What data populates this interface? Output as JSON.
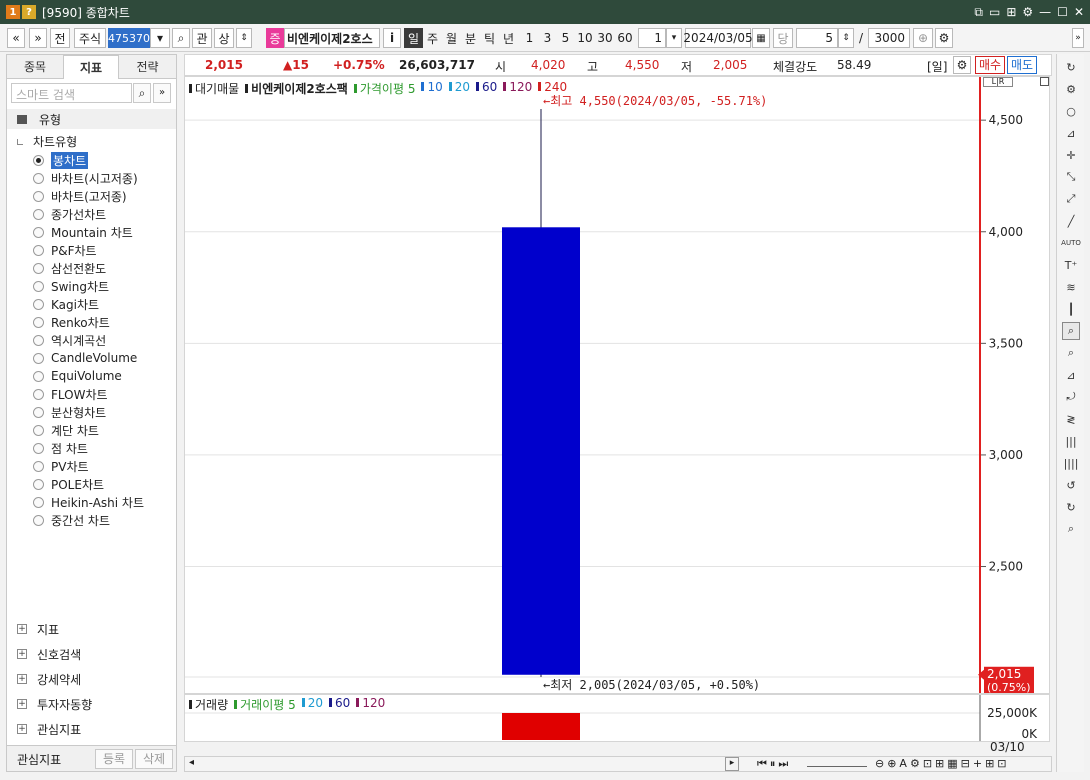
{
  "window": {
    "title": "[9590] 종합차트",
    "icon1": "1",
    "icon2": "?",
    "buttons": [
      "⧉",
      "▭",
      "⊞",
      "⚙",
      "—",
      "☐",
      "✕"
    ]
  },
  "toolbar": {
    "back": "«",
    "down": "»",
    "prev_label": "전",
    "type_label": "주식",
    "code": "475370",
    "rel_label": "관",
    "up_label": "상",
    "market_badge": "증",
    "stock_name": "비엔케이제2호스",
    "info_label": "i",
    "periods": [
      "일",
      "주",
      "월",
      "분",
      "틱",
      "년"
    ],
    "intervals": [
      "1",
      "3",
      "5",
      "10",
      "30",
      "60"
    ],
    "count": "1",
    "date": "2024/03/05",
    "per_label": "당",
    "display_count": "5",
    "slash": "/",
    "total": "3000"
  },
  "left_panel": {
    "tabs": [
      "종목",
      "지표",
      "전략"
    ],
    "search_placeholder": "스마트 검색",
    "group_label": "유형",
    "subgroup_label": "차트유형",
    "chart_types": [
      "봉차트",
      "바차트(시고저종)",
      "바차트(고저종)",
      "종가선차트",
      "Mountain 차트",
      "P&F차트",
      "삼선전환도",
      "Swing차트",
      "Kagi차트",
      "Renko차트",
      "역시계곡선",
      "CandleVolume",
      "EquiVolume",
      "FLOW차트",
      "분산형차트",
      "계단 차트",
      "점 차트",
      "PV차트",
      "POLE차트",
      "Heikin-Ashi 차트",
      "중간선 차트"
    ],
    "bottom_sections": [
      "지표",
      "신호검색",
      "강세약세",
      "투자자동향",
      "관심지표"
    ],
    "fav_label": "관심지표",
    "register_label": "등록",
    "delete_label": "삭제"
  },
  "quote": {
    "price": "2,015",
    "change": "▲15",
    "rate": "+0.75%",
    "volume": "26,603,717",
    "open_label": "시",
    "open": "4,020",
    "high_label": "고",
    "high": "4,550",
    "low_label": "저",
    "low": "2,005",
    "strength_label": "체결강도",
    "strength": "58.49",
    "period_tag": "[일]",
    "buy_label": "매수",
    "sell_label": "매도"
  },
  "legend": {
    "items": [
      "대기매물",
      "비엔케이제2호스팩",
      "가격이평 5",
      "10",
      "20",
      "60",
      "120",
      "240"
    ],
    "colors": [
      "#222222",
      "#222222",
      "#2e9a2e",
      "#1f6fd1",
      "#1f9bd1",
      "#1a1a8a",
      "#8a1a5a",
      "#d12020"
    ]
  },
  "vol_legend": {
    "items": [
      "거래량",
      "거래이평 5",
      "20",
      "60",
      "120"
    ],
    "colors": [
      "#222222",
      "#2e9a2e",
      "#1f9bd1",
      "#1a1a8a",
      "#8a1a5a"
    ]
  },
  "annotations": {
    "high": "←최고 4,550(2024/03/05, -55.71%)",
    "low": "←최저 2,005(2024/03/05, +0.50%)"
  },
  "price_tag": {
    "price": "2,015",
    "rate": "(0.75%)"
  },
  "vol_axis": {
    "top": "25,000K",
    "bottom": "0K"
  },
  "date_label": "03/10",
  "chart_data": {
    "type": "candlestick",
    "candles": [
      {
        "date": "2024/03/05",
        "open": 4020,
        "high": 4550,
        "low": 2005,
        "close": 2015
      }
    ],
    "volume": [
      {
        "date": "2024/03/05",
        "value": 26603717
      }
    ],
    "price_ticks": [
      2500,
      3000,
      3500,
      4000,
      4500
    ],
    "price_ticks_text": [
      "2,500",
      "3,000",
      "3,500",
      "4,000",
      "4,500"
    ],
    "ylim": [
      2005,
      4550
    ],
    "volume_ylim": [
      0,
      25000000
    ]
  }
}
